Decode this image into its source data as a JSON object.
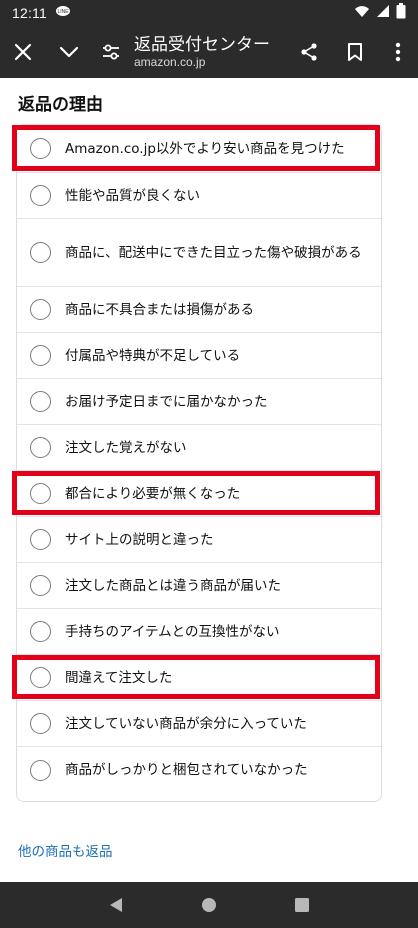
{
  "status_bar": {
    "time": "12:11",
    "notification_icon": "line-app-icon",
    "right_icons": [
      "wifi-icon",
      "cell-signal-icon",
      "battery-icon"
    ]
  },
  "toolbar": {
    "title": "返品受付センター",
    "url": "amazon.co.jp",
    "icons": [
      "close-icon",
      "chevron-down-icon",
      "page-settings-icon",
      "share-icon",
      "bookmark-icon",
      "more-vert-icon"
    ]
  },
  "page_title": "返品の理由",
  "reasons": [
    {
      "label": "Amazon.co.jp以外でより安い商品を見つけた",
      "selected": false,
      "highlighted": true
    },
    {
      "label": "性能や品質が良くない",
      "selected": false,
      "highlighted": false
    },
    {
      "label": "商品に、配送中にできた目立った傷や破損がある",
      "selected": false,
      "highlighted": false
    },
    {
      "label": "商品に不具合または損傷がある",
      "selected": false,
      "highlighted": false
    },
    {
      "label": "付属品や特典が不足している",
      "selected": false,
      "highlighted": false
    },
    {
      "label": "お届け予定日までに届かなかった",
      "selected": false,
      "highlighted": false
    },
    {
      "label": "注文した覚えがない",
      "selected": false,
      "highlighted": false
    },
    {
      "label": "都合により必要が無くなった",
      "selected": false,
      "highlighted": true
    },
    {
      "label": "サイト上の説明と違った",
      "selected": false,
      "highlighted": false
    },
    {
      "label": "注文した商品とは違う商品が届いた",
      "selected": false,
      "highlighted": false
    },
    {
      "label": "手持ちのアイテムとの互換性がない",
      "selected": false,
      "highlighted": false
    },
    {
      "label": "間違えて注文した",
      "selected": false,
      "highlighted": true
    },
    {
      "label": "注文していない商品が余分に入っていた",
      "selected": false,
      "highlighted": false
    },
    {
      "label": "商品がしっかりと梱包されていなかった",
      "selected": false,
      "highlighted": false
    }
  ],
  "more_link": "他の商品も返品",
  "colors": {
    "bar_background": "#2b2b2b",
    "highlight_border": "#e3001b",
    "link": "#1a6fb5",
    "radio_border": "#7a7a7a"
  },
  "nav_bar": {
    "icons": [
      "back-icon",
      "home-icon",
      "recents-icon"
    ]
  }
}
